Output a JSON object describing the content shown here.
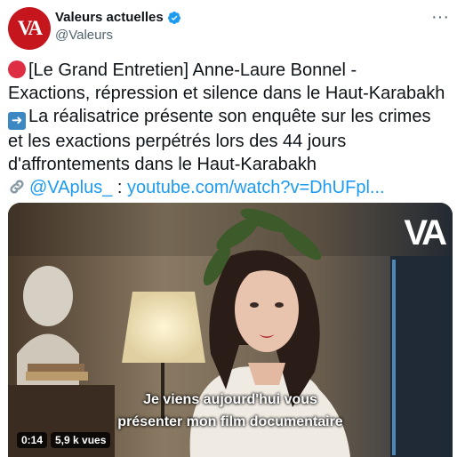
{
  "tweet": {
    "avatar_text": "VA",
    "display_name": "Valeurs actuelles",
    "verified_icon": "verified-badge-icon",
    "handle": "@Valeurs",
    "text_lines": {
      "l1": "[Le Grand Entretien] Anne-Laure Bonnel -",
      "l2": "Exactions, répression et silence dans le Haut-Karabakh",
      "l3": "La réalisatrice présente son enquête sur les crimes",
      "l4": "et les exactions perpétrés lors des 44 jours",
      "l5": "d'affrontements dans le Haut-Karabakh"
    },
    "mention": "@VAplus_",
    "separator": ":",
    "url": "youtube.com/watch?v=DhUFpl..."
  },
  "video": {
    "logo_text": "VA",
    "subtitle_line1": "Je viens aujourd'hui vous",
    "subtitle_line2": "présenter mon film documentaire",
    "timestamp": "0:14",
    "views": "5,9 k vues"
  },
  "colors": {
    "brand_red": "#c5161d",
    "link_blue": "#1d9bf0",
    "verified_blue": "#1d9bf0"
  }
}
